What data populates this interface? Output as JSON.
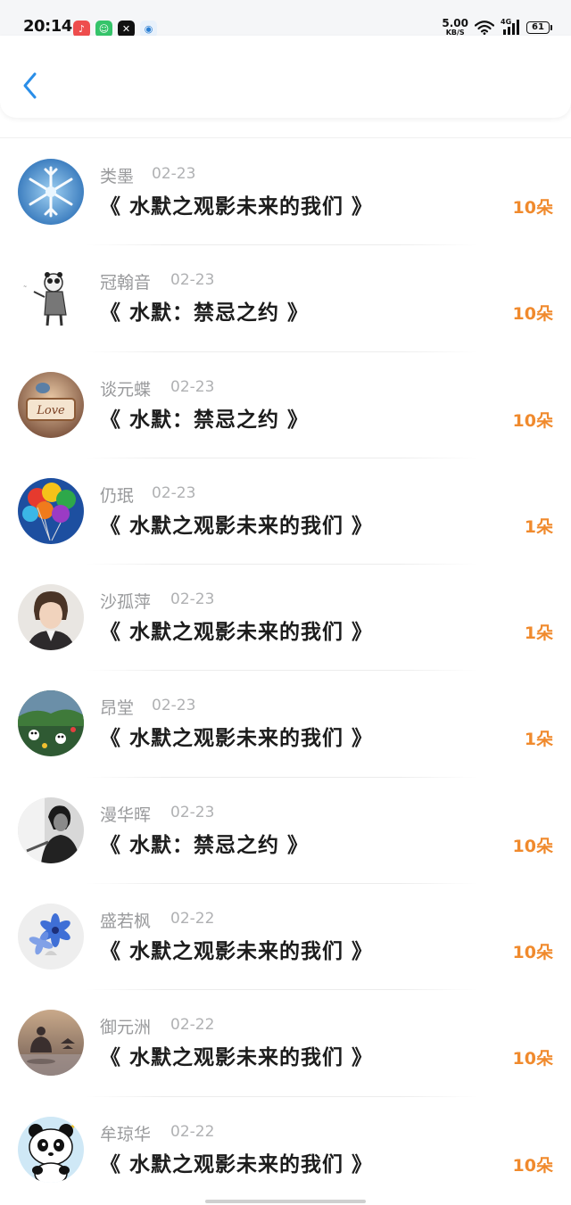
{
  "status_bar": {
    "time": "20:14",
    "net_speed": "5.00",
    "net_unit": "KB/S",
    "network": "4G",
    "battery": "61",
    "app_icons": [
      "music-app-icon",
      "green-app-icon",
      "capcut-app-icon",
      "blue-app-icon"
    ]
  },
  "nav": {
    "back_icon": "chevron-left-icon",
    "accent": "#2a8ee8"
  },
  "colors": {
    "amount": "#f08a2d",
    "name": "#999a9c"
  },
  "gifts": [
    {
      "name": "类墨",
      "date": "02-23",
      "title": "《 水默之观影未来的我们 》",
      "amount": "10朵",
      "avatar": "snowflake-avatar"
    },
    {
      "name": "冠翰音",
      "date": "02-23",
      "title": "《 水默：禁忌之约 》",
      "amount": "10朵",
      "avatar": "panda-sketch-avatar"
    },
    {
      "name": "谈元蝶",
      "date": "02-23",
      "title": "《 水默：禁忌之约 》",
      "amount": "10朵",
      "avatar": "love-sign-avatar"
    },
    {
      "name": "仍珉",
      "date": "02-23",
      "title": "《 水默之观影未来的我们 》",
      "amount": "1朵",
      "avatar": "balloons-avatar"
    },
    {
      "name": "沙孤萍",
      "date": "02-23",
      "title": "《 水默之观影未来的我们 》",
      "amount": "1朵",
      "avatar": "person-avatar"
    },
    {
      "name": "昂堂",
      "date": "02-23",
      "title": "《 水默之观影未来的我们 》",
      "amount": "1朵",
      "avatar": "garden-avatar"
    },
    {
      "name": "漫华晖",
      "date": "02-23",
      "title": "《 水默：禁忌之约 》",
      "amount": "10朵",
      "avatar": "bw-portrait-avatar"
    },
    {
      "name": "盛若枫",
      "date": "02-22",
      "title": "《 水默之观影未来的我们 》",
      "amount": "10朵",
      "avatar": "blue-flower-avatar"
    },
    {
      "name": "御元洲",
      "date": "02-22",
      "title": "《 水默之观影未来的我们 》",
      "amount": "10朵",
      "avatar": "buddha-avatar"
    },
    {
      "name": "牟琼华",
      "date": "02-22",
      "title": "《 水默之观影未来的我们 》",
      "amount": "10朵",
      "avatar": "panda-avatar"
    }
  ]
}
